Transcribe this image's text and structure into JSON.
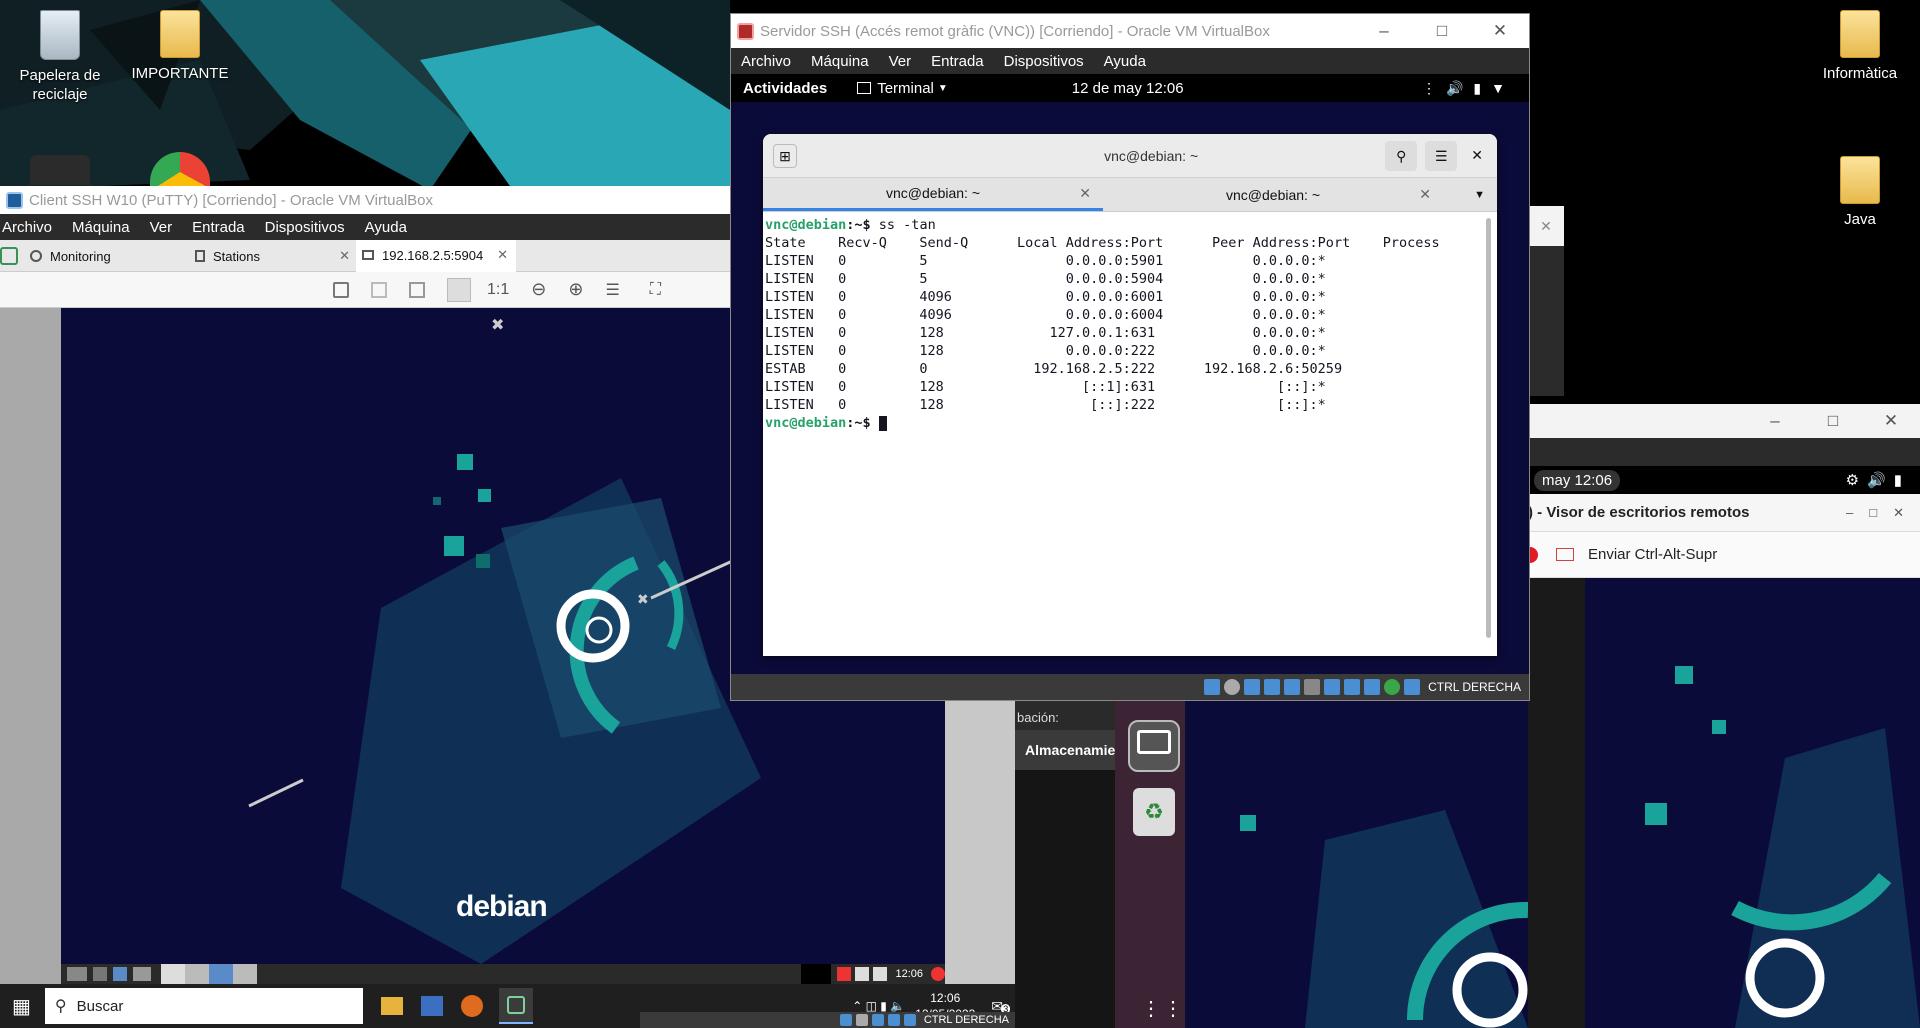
{
  "desktop": {
    "icons": [
      {
        "label": "Papelera de reciclaje"
      },
      {
        "label": "IMPORTANTE"
      },
      {
        "label": "Informàtica"
      },
      {
        "label": "Java"
      }
    ]
  },
  "client_vm": {
    "title": "Client SSH W10 (PuTTY) [Corriendo] - Oracle VM VirtualBox",
    "menu": [
      "Archivo",
      "Máquina",
      "Ver",
      "Entrada",
      "Dispositivos",
      "Ayuda"
    ],
    "tabs": [
      {
        "label": "Monitoring"
      },
      {
        "label": "Stations"
      },
      {
        "label": "192.168.2.5:5904"
      }
    ],
    "toolbar": {
      "scale_label": "1:1"
    },
    "guest_brand": "debian",
    "guest_panel_time": "12:06",
    "taskbar": {
      "search_placeholder": "Buscar",
      "time": "12:06",
      "date": "12/05/2023",
      "notification_count": "3"
    },
    "status_host_key": "CTRL DERECHA"
  },
  "server_vm": {
    "title": "Servidor SSH (Accés remot gràfic (VNC)) [Corriendo] - Oracle VM VirtualBox",
    "menu": [
      "Archivo",
      "Máquina",
      "Ver",
      "Entrada",
      "Dispositivos",
      "Ayuda"
    ],
    "gnome": {
      "activities": "Actividades",
      "app_menu": "Terminal",
      "clock": "12 de may  12:06"
    },
    "terminal": {
      "title": "vnc@debian: ~",
      "tabs": [
        {
          "label": "vnc@debian: ~"
        },
        {
          "label": "vnc@debian: ~"
        }
      ],
      "prompt_user": "vnc@debian",
      "prompt_path": ":~$",
      "command": " ss -tan",
      "header": "State    Recv-Q    Send-Q      Local Address:Port      Peer Address:Port    Process",
      "rows": [
        "LISTEN   0         5                 0.0.0.0:5901           0.0.0.0:*",
        "LISTEN   0         5                 0.0.0.0:5904           0.0.0.0:*",
        "LISTEN   0         4096              0.0.0.0:6001           0.0.0.0:*",
        "LISTEN   0         4096              0.0.0.0:6004           0.0.0.0:*",
        "LISTEN   0         128             127.0.0.1:631            0.0.0.0:*",
        "LISTEN   0         128               0.0.0.0:222            0.0.0.0:*",
        "ESTAB    0         0             192.168.2.5:222      192.168.2.6:50259",
        "LISTEN   0         128                 [::1]:631               [::]:*",
        "LISTEN   0         128                  [::]:222               [::]:*"
      ],
      "final_prompt_path": ":~$ "
    },
    "status_host_key": "CTRL DERECHA"
  },
  "third_vm": {
    "gnome_clock": "may  12:06",
    "remote_viewer_title": ") - Visor de escritorios remotos",
    "send_keys_label": "Enviar Ctrl-Alt-Supr",
    "side_text_1": "bación:",
    "side_label": "Almacenamie"
  },
  "colors": {
    "debian_bg": "#0b0b3a",
    "debian_accent": "#1aa39a",
    "terminal_prompt": "#26a269",
    "terminal_bg": "#ffffff",
    "vbox_menu": "#2b2b2b",
    "taskbar": "#1f1f1f"
  }
}
